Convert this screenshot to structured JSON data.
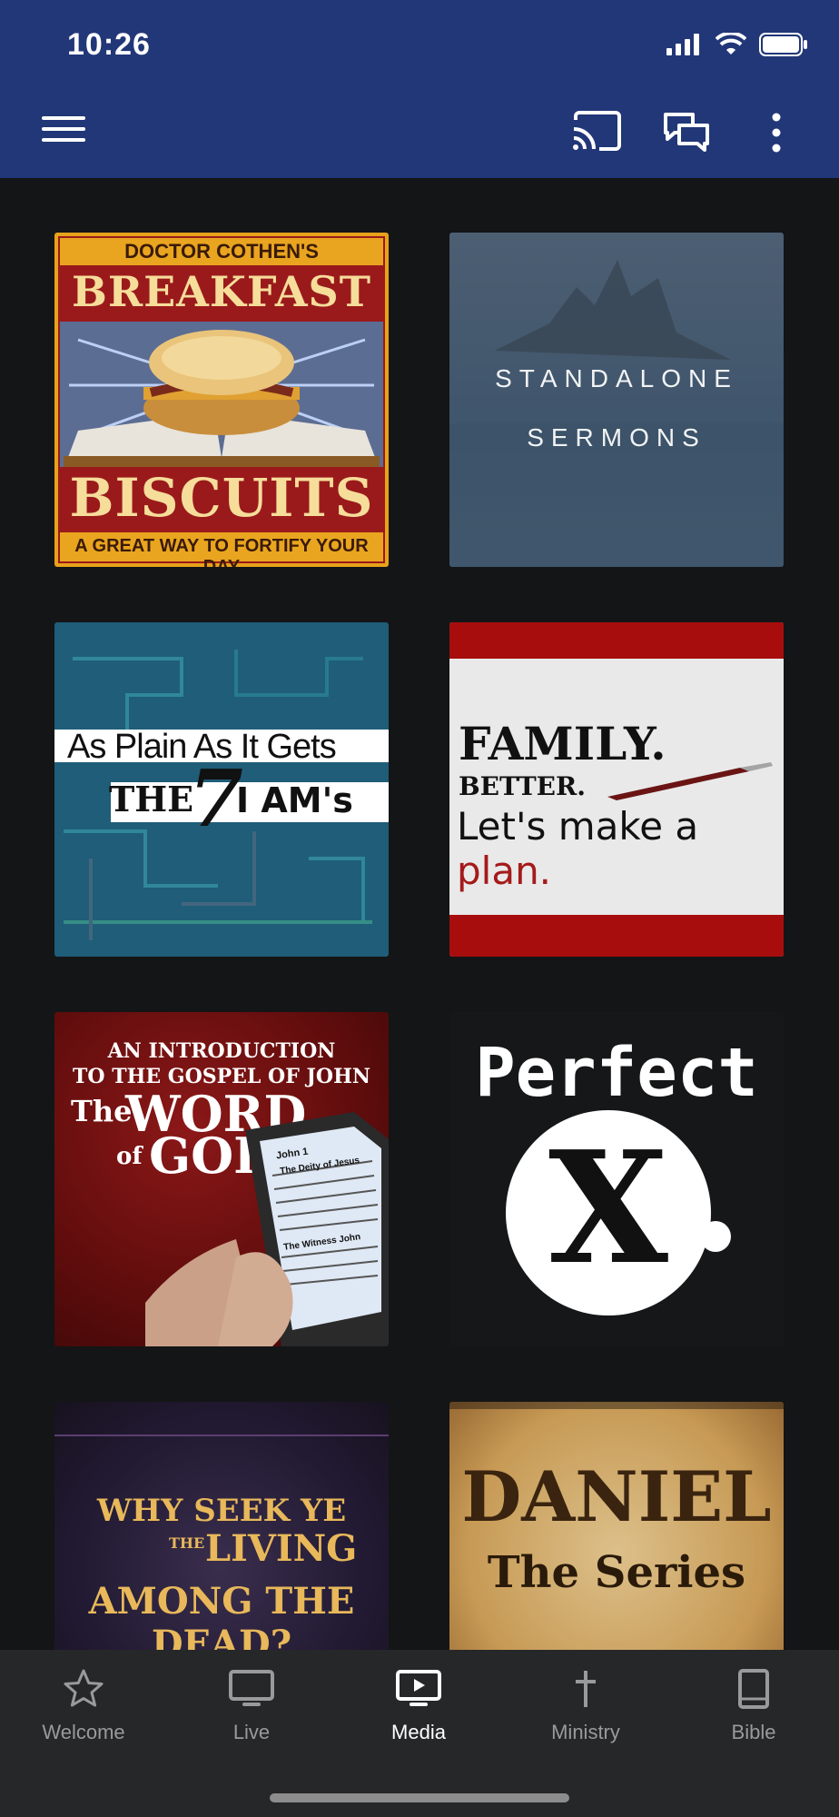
{
  "status": {
    "time": "10:26"
  },
  "toolbar": {
    "menu_icon": "hamburger-menu-icon",
    "cast_icon": "cast-icon",
    "chat_icon": "chat-bubbles-icon",
    "more_icon": "more-vertical-icon"
  },
  "tiles": {
    "breakfast": {
      "top": "DOCTOR COTHEN'S",
      "title1": "BREAKFAST",
      "title2": "BISCUITS",
      "tag": "A GREAT WAY TO FORTIFY YOUR DAY"
    },
    "standalone": {
      "line1": "STANDALONE",
      "line2": "SERMONS"
    },
    "plain": {
      "line1": "As Plain As It Gets",
      "the": "THE",
      "seven": "7",
      "iam": "I AM's"
    },
    "family": {
      "f1": "FAMILY.",
      "f2": "BETTER.",
      "f3a": "Let's make a",
      "f3b": "plan."
    },
    "john": {
      "l1": "AN INTRODUCTION",
      "l2": "TO THE GOSPEL OF JOHN",
      "the": "The",
      "word": "WORD",
      "of": "of",
      "god": "GOD",
      "phone_title": "John 1",
      "phone_sub": "The Deity of Jesus",
      "phone_sub2": "The Witness John"
    },
    "perfect": {
      "word": "Perfect",
      "x": "X",
      "dot": "."
    },
    "seek": {
      "l1": "WHY SEEK YE",
      "the": "THE",
      "living": "LIVING",
      "l3": "AMONG THE DEAD?"
    },
    "daniel": {
      "l1": "DANIEL",
      "l2": "The Series"
    }
  },
  "nav": [
    {
      "label": "Welcome",
      "icon": "star-icon"
    },
    {
      "label": "Live",
      "icon": "tv-icon"
    },
    {
      "label": "Media",
      "icon": "play-screen-icon"
    },
    {
      "label": "Ministry",
      "icon": "cross-icon"
    },
    {
      "label": "Bible",
      "icon": "book-icon"
    }
  ],
  "colors": {
    "header": "#223778",
    "background": "#141516",
    "nav": "#262729",
    "active": "#ffffff",
    "inactive": "#9a9a9a"
  }
}
